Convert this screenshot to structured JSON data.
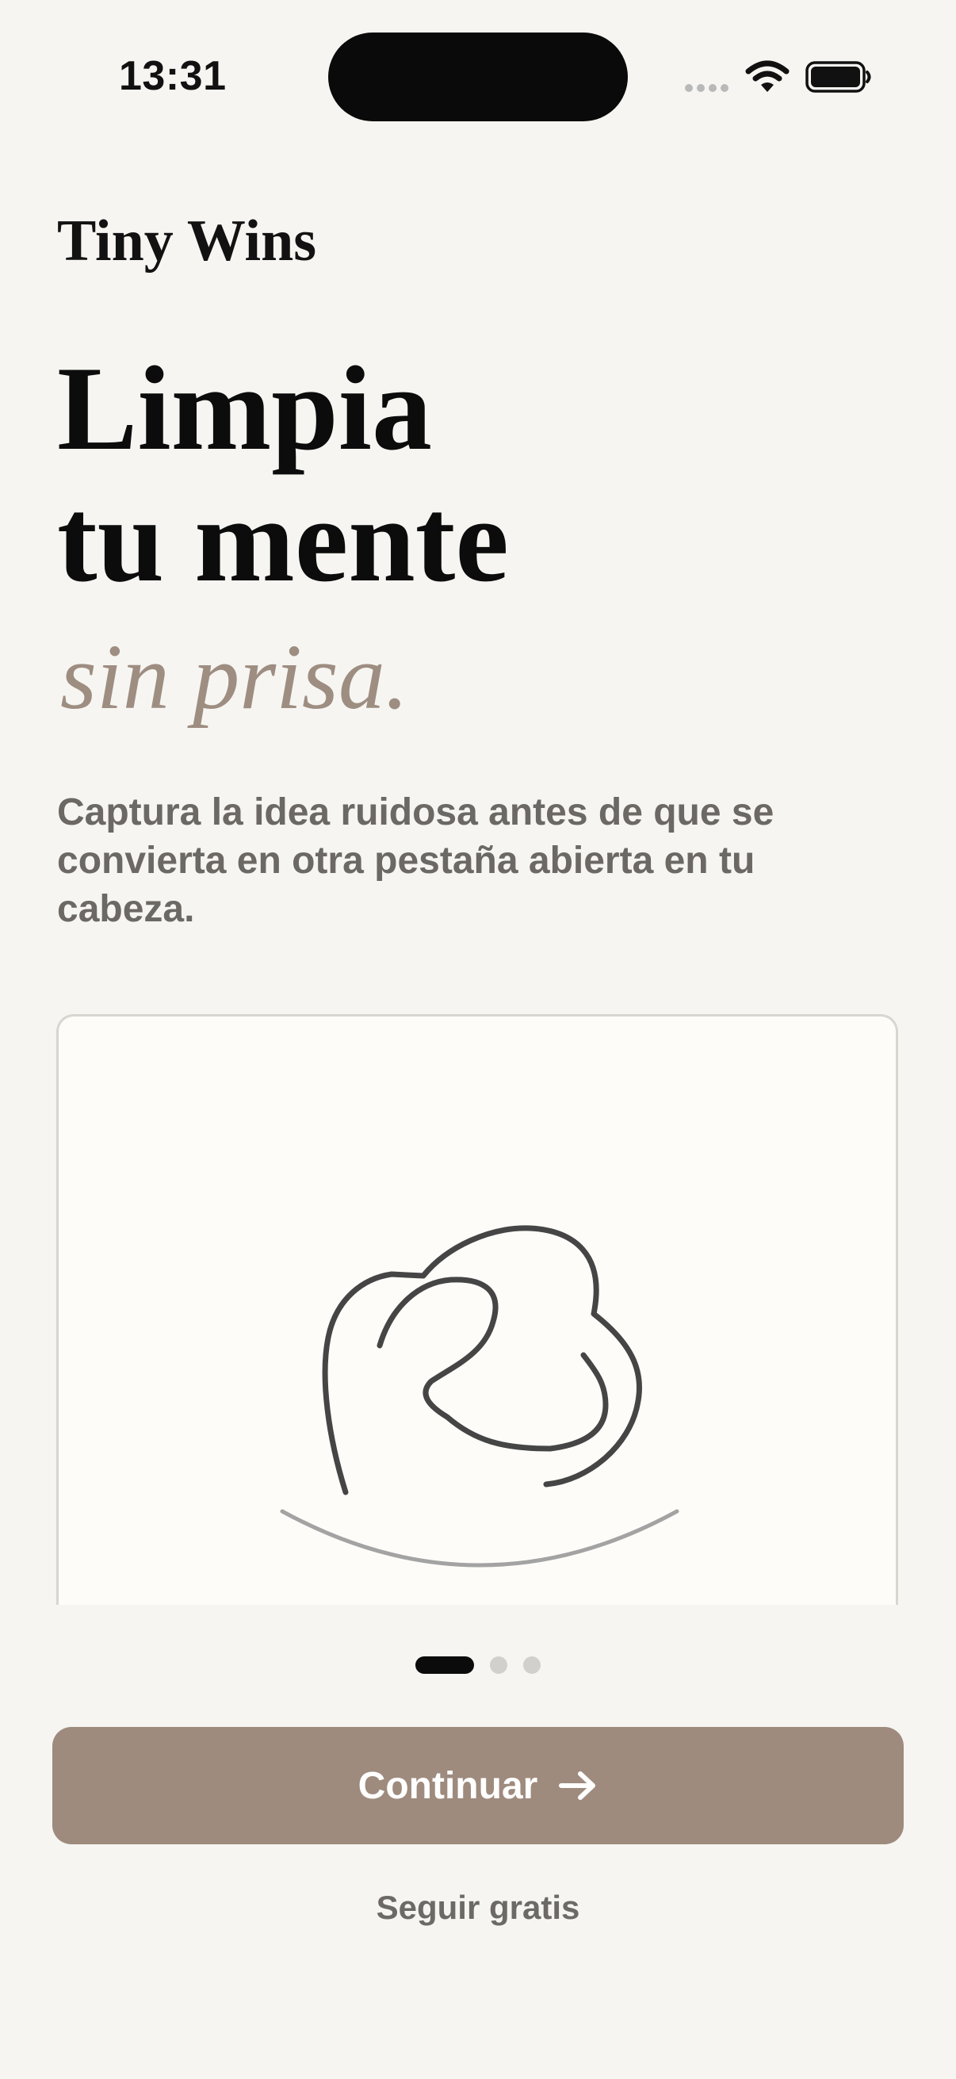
{
  "status_bar": {
    "time": "13:31",
    "icons": [
      "cellular-signal-icon",
      "wifi-icon",
      "battery-icon"
    ]
  },
  "app": {
    "name": "Tiny Wins"
  },
  "hero": {
    "headline_line1": "Limpia",
    "headline_line2": "tu mente",
    "headline_accent": "sin prisa.",
    "description": "Captura la idea ruidosa antes de que se convierta en otra pestaña abierta en tu cabeza."
  },
  "illustration": {
    "icon": "brain-cloud-line-icon"
  },
  "pager": {
    "total_pages": 3,
    "current_page": 1
  },
  "actions": {
    "primary_label": "Continuar",
    "primary_icon": "arrow-right-icon",
    "secondary_label": "Seguir gratis"
  },
  "colors": {
    "background": "#f6f5f1",
    "accent": "#9e8b7e",
    "headline_accent": "#9e8d81",
    "text_primary": "#0c0c0c",
    "text_secondary": "#6c6863"
  }
}
